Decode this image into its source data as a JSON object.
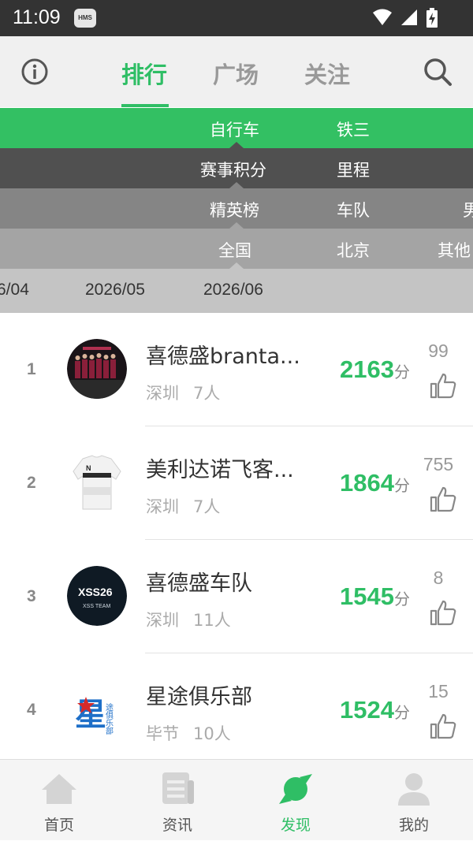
{
  "status_bar": {
    "time": "11:09",
    "hms_badge": "HMS"
  },
  "header": {
    "tabs": [
      {
        "label": "排行",
        "active": true
      },
      {
        "label": "广场",
        "active": false
      },
      {
        "label": "关注",
        "active": false
      }
    ],
    "accent_color": "#2fbe65"
  },
  "filters": {
    "sport": [
      "自行车",
      "铁三"
    ],
    "category": [
      "赛事积分",
      "里程"
    ],
    "ranking": [
      "精英榜",
      "车队",
      "男"
    ],
    "region": [
      "全国",
      "北京",
      "其他"
    ],
    "months": [
      "6/04",
      "2026/05",
      "2026/06"
    ]
  },
  "rankings": [
    {
      "rank": "1",
      "name": "喜德盛branta...",
      "city": "深圳",
      "members": "7人",
      "score": "2163",
      "unit": "分",
      "likes": "99",
      "avatar": "team-group-photo"
    },
    {
      "rank": "2",
      "name": "美利达诺飞客...",
      "city": "深圳",
      "members": "7人",
      "score": "1864",
      "unit": "分",
      "likes": "755",
      "avatar": "cycling-jersey"
    },
    {
      "rank": "3",
      "name": "喜德盛车队",
      "city": "深圳",
      "members": "11人",
      "score": "1545",
      "unit": "分",
      "likes": "8",
      "avatar": "xss-team-logo"
    },
    {
      "rank": "4",
      "name": "星途俱乐部",
      "city": "毕节",
      "members": "10人",
      "score": "1524",
      "unit": "分",
      "likes": "15",
      "avatar": "star-club-logo"
    }
  ],
  "bottom_nav": [
    {
      "label": "首页",
      "icon": "home-icon",
      "active": false
    },
    {
      "label": "资讯",
      "icon": "news-icon",
      "active": false
    },
    {
      "label": "发现",
      "icon": "discover-icon",
      "active": true
    },
    {
      "label": "我的",
      "icon": "profile-icon",
      "active": false
    }
  ],
  "avatar_logo_text": {
    "row3_top": "XSS26",
    "row3_bottom": "XSS TEAM",
    "row4_star": "星",
    "row4_side": "途俱乐部"
  }
}
